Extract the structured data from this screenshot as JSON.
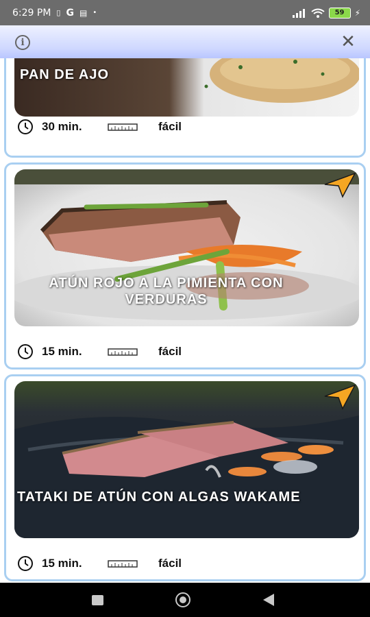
{
  "status_bar": {
    "time": "6:29 PM",
    "icons": [
      "sim-card-icon",
      "google-icon",
      "message-icon",
      "dot-icon"
    ],
    "battery": "59"
  },
  "top_bar": {
    "info_icon": "info-icon",
    "close_icon": "close-icon"
  },
  "recipes": [
    {
      "title": "PAN DE AJO",
      "time": "30 min.",
      "difficulty": "fácil"
    },
    {
      "title": "ATÚN ROJO A LA PIMIENTA CON VERDURAS",
      "time": "15 min.",
      "difficulty": "fácil"
    },
    {
      "title": "TATAKI DE ATÚN CON ALGAS WAKAME",
      "time": "15 min.",
      "difficulty": "fácil"
    }
  ],
  "colors": {
    "card_border": "#a9cff1",
    "share_icon": "#f5a623",
    "top_bar": "#cfd8ff"
  }
}
